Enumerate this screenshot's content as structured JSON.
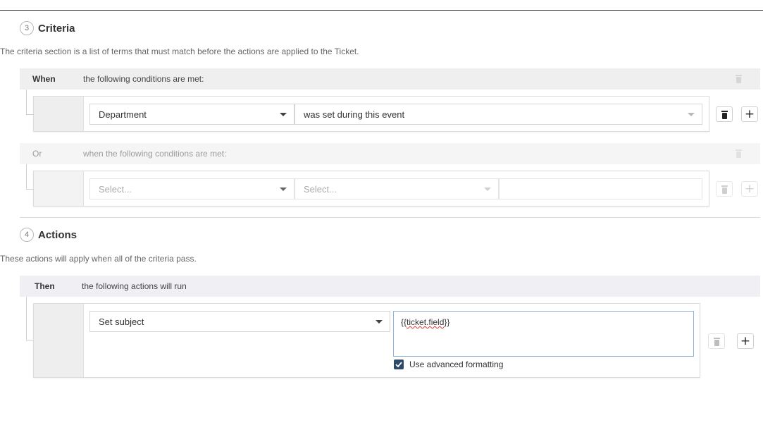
{
  "criteria": {
    "step_number": "3",
    "title": "Criteria",
    "description": "The criteria section is a list of terms that must match before the actions are applied to the Ticket.",
    "when_group": {
      "keyword": "When",
      "text": "the following conditions are met:",
      "field_select": "Department",
      "operator_select": "was set during this event"
    },
    "or_group": {
      "keyword": "Or",
      "text": "when the following conditions are met:",
      "field_placeholder": "Select...",
      "operator_placeholder": "Select..."
    }
  },
  "actions": {
    "step_number": "4",
    "title": "Actions",
    "description": "These actions will apply when all of the criteria pass.",
    "then_group": {
      "keyword": "Then",
      "text": "the following actions will run",
      "action_select": "Set subject",
      "value_prefix": "{{",
      "value_token": "ticket.field",
      "value_suffix": "}}",
      "advanced_label": "Use advanced formatting",
      "advanced_checked": true
    }
  },
  "icons": {
    "trash": "trash-icon",
    "plus": "plus-icon",
    "caret": "caret-down-icon",
    "check": "checkmark-icon"
  },
  "colors": {
    "bar_grey": "#efefef",
    "bar_lavender": "#f0f0f4",
    "checkbox": "#2d4a6b",
    "focus_border": "#8fb2d9"
  }
}
